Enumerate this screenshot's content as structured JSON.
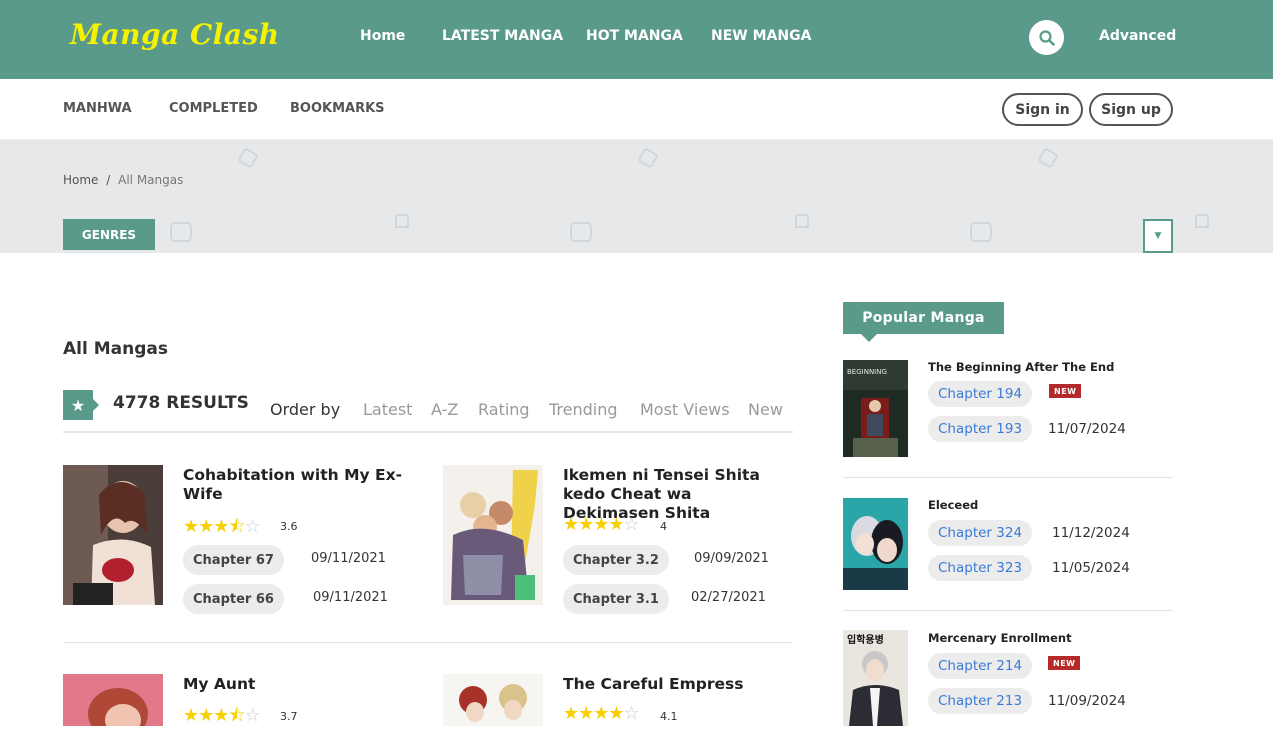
{
  "header": {
    "logo": "Manga Clash",
    "nav": [
      "Home",
      "LATEST MANGA",
      "HOT MANGA",
      "NEW MANGA"
    ],
    "advanced": "Advanced"
  },
  "subnav": {
    "links": [
      "MANHWA",
      "COMPLETED",
      "BOOKMARKS"
    ],
    "sign_in": "Sign in",
    "sign_up": "Sign up"
  },
  "breadcrumb": {
    "home": "Home",
    "separator": "/",
    "current": "All Mangas"
  },
  "genres_button": "GENRES",
  "listing": {
    "title": "All Mangas",
    "results": "4778 RESULTS",
    "order_by_label": "Order by",
    "order_options": [
      "Latest",
      "A-Z",
      "Rating",
      "Trending",
      "Most Views",
      "New"
    ]
  },
  "mangas": [
    {
      "title": "Cohabitation with My Ex-Wife",
      "rating": "3.6",
      "stars": 3.5,
      "chapters": [
        {
          "label": "Chapter 67",
          "date": "09/11/2021"
        },
        {
          "label": "Chapter 66",
          "date": "09/11/2021"
        }
      ]
    },
    {
      "title": "Ikemen ni Tensei Shita kedo Cheat wa Dekimasen Shita",
      "rating": "4",
      "stars": 4,
      "chapters": [
        {
          "label": "Chapter 3.2",
          "date": "09/09/2021"
        },
        {
          "label": "Chapter 3.1",
          "date": "02/27/2021"
        }
      ]
    },
    {
      "title": "My Aunt",
      "rating": "3.7",
      "stars": 3.5,
      "chapters": []
    },
    {
      "title": "The Careful Empress",
      "rating": "4.1",
      "stars": 4,
      "chapters": []
    }
  ],
  "popular": {
    "heading": "Popular Manga",
    "new_badge": "NEW",
    "items": [
      {
        "title": "The Beginning After The End",
        "chapters": [
          {
            "label": "Chapter 194",
            "date": ""
          },
          {
            "label": "Chapter 193",
            "date": "11/07/2024"
          }
        ]
      },
      {
        "title": "Eleceed",
        "chapters": [
          {
            "label": "Chapter 324",
            "date": "11/12/2024"
          },
          {
            "label": "Chapter 323",
            "date": "11/05/2024"
          }
        ]
      },
      {
        "title": "Mercenary Enrollment",
        "chapters": [
          {
            "label": "Chapter 214",
            "date": ""
          },
          {
            "label": "Chapter 213",
            "date": "11/09/2024"
          }
        ]
      }
    ]
  },
  "colors": {
    "brand": "#5a9a8a",
    "logo": "#f4f200",
    "star": "#f6d000",
    "link": "#3a7bd5",
    "new_badge": "#b42a2a"
  },
  "icons": {
    "search": "search-icon",
    "star": "star-icon",
    "dropdown": "caret-down-icon"
  }
}
